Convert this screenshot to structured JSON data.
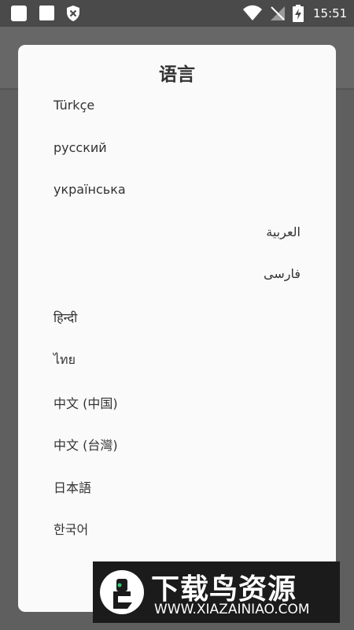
{
  "status_bar": {
    "time": "15:51",
    "icons": [
      "square-notification-icon",
      "square-notification-icon",
      "shield-icon",
      "wifi-icon",
      "no-signal-icon",
      "battery-charging-icon"
    ]
  },
  "dialog": {
    "title": "语言",
    "languages": [
      {
        "label": "Türkçe",
        "dir": "ltr"
      },
      {
        "label": "русский",
        "dir": "ltr"
      },
      {
        "label": "українська",
        "dir": "ltr"
      },
      {
        "label": "العربية",
        "dir": "rtl"
      },
      {
        "label": "فارسی",
        "dir": "rtl"
      },
      {
        "label": "हिन्दी",
        "dir": "ltr"
      },
      {
        "label": "ไทย",
        "dir": "ltr"
      },
      {
        "label": "中文 (中国)",
        "dir": "ltr"
      },
      {
        "label": "中文 (台灣)",
        "dir": "ltr"
      },
      {
        "label": "日本語",
        "dir": "ltr"
      },
      {
        "label": "한국어",
        "dir": "ltr"
      }
    ]
  },
  "watermark": {
    "title": "下载鸟资源",
    "url": "WWW.XIAZAINIAO.COM"
  },
  "colors": {
    "overlay": "#5f5f5f",
    "dialog_bg": "#fafafa",
    "text": "#333333",
    "watermark_bg": "#1b1b1b"
  }
}
